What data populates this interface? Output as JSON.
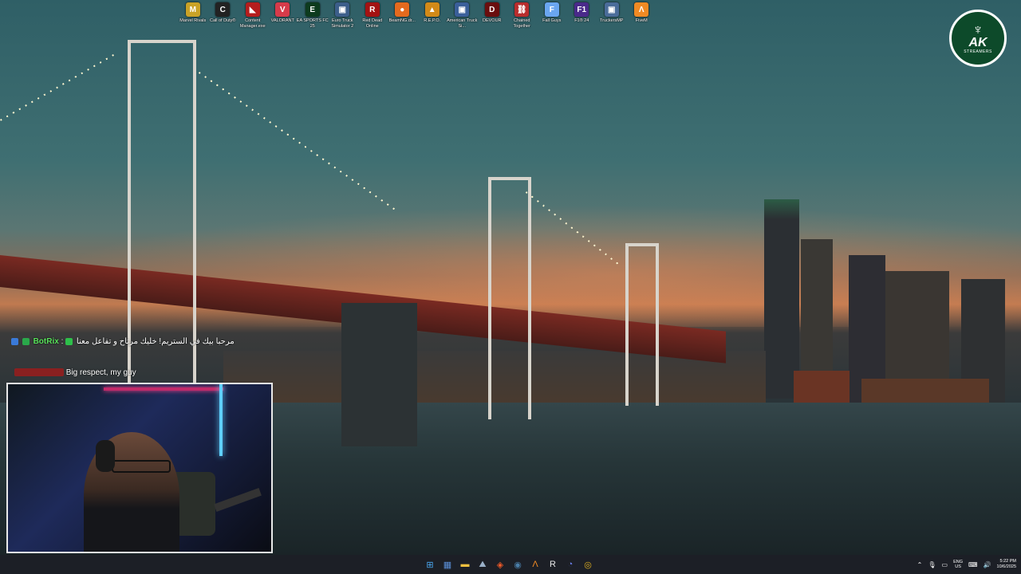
{
  "desktop": {
    "icons": [
      {
        "label": "Marvel Rivals",
        "icon": "marvel-rivals-icon",
        "color": "#c9a227",
        "glyph": "M"
      },
      {
        "label": "Call of Duty®",
        "icon": "call-of-duty-icon",
        "color": "#222222",
        "glyph": "C"
      },
      {
        "label": "Content Manager.exe",
        "icon": "content-manager-icon",
        "color": "#b51d1d",
        "glyph": "◣"
      },
      {
        "label": "VALORANT",
        "icon": "valorant-icon",
        "color": "#d63b4a",
        "glyph": "V"
      },
      {
        "label": "EA SPORTS FC 25",
        "icon": "ea-fc25-icon",
        "color": "#0d3b1e",
        "glyph": "E"
      },
      {
        "label": "Euro Truck Simulator 2",
        "icon": "euro-truck-icon",
        "color": "#3c5e8a",
        "glyph": "▣"
      },
      {
        "label": "Red Dead Online",
        "icon": "red-dead-icon",
        "color": "#a31212",
        "glyph": "R"
      },
      {
        "label": "BeamNG.dr...",
        "icon": "beamng-icon",
        "color": "#e46a1e",
        "glyph": "●"
      },
      {
        "label": "R.E.P.O.",
        "icon": "repo-icon",
        "color": "#d28a18",
        "glyph": "▲"
      },
      {
        "label": "American Truck Si...",
        "icon": "american-truck-icon",
        "color": "#3a5f9a",
        "glyph": "▣"
      },
      {
        "label": "DEVOUR",
        "icon": "devour-icon",
        "color": "#6a0e0e",
        "glyph": "D"
      },
      {
        "label": "Chained Together",
        "icon": "chained-together-icon",
        "color": "#b82d2d",
        "glyph": "⛓"
      },
      {
        "label": "Fall Guys",
        "icon": "fall-guys-icon",
        "color": "#6aa6f0",
        "glyph": "F"
      },
      {
        "label": "F1® 24",
        "icon": "f1-24-icon",
        "color": "#4a2a8a",
        "glyph": "F1"
      },
      {
        "label": "TruckersMP",
        "icon": "truckersmp-icon",
        "color": "#4a6c9a",
        "glyph": "▣"
      },
      {
        "label": "FiveM",
        "icon": "fivem-icon",
        "color": "#f08a24",
        "glyph": "Λ"
      }
    ]
  },
  "logo": {
    "title": "AK",
    "subtitle": "STREAMERS"
  },
  "chat": {
    "messages": [
      {
        "user": "BotRix",
        "separator": ":",
        "text": "مرحبا بيك في الستريم! خليك مرتاح و تفاعل معنا",
        "user_color": "#58e05a"
      },
      {
        "user": "",
        "separator": ":",
        "text": "Big respect, my guy",
        "user_color": "#e03c3c"
      }
    ]
  },
  "taskbar": {
    "apps": [
      {
        "icon": "windows-start-icon",
        "glyph": "⊞",
        "color": "#4aa8f0"
      },
      {
        "icon": "calendar-icon",
        "glyph": "▦",
        "color": "#5a8fd8"
      },
      {
        "icon": "file-explorer-icon",
        "glyph": "▬",
        "color": "#f0c040"
      },
      {
        "icon": "photos-icon",
        "glyph": "⛰",
        "color": "#9ab0c8"
      },
      {
        "icon": "brave-browser-icon",
        "glyph": "◈",
        "color": "#f05a28"
      },
      {
        "icon": "steam-icon",
        "glyph": "◉",
        "color": "#4a7ea8"
      },
      {
        "icon": "fivem-taskbar-icon",
        "glyph": "Λ",
        "color": "#f08a24"
      },
      {
        "icon": "rockstar-icon",
        "glyph": "R",
        "color": "#e8e8e8"
      },
      {
        "icon": "discord-icon",
        "glyph": "◔",
        "color": "#6a7ee8"
      },
      {
        "icon": "chrome-icon",
        "glyph": "◎",
        "color": "#e0b020"
      }
    ],
    "tray": {
      "lang_top": "ENG",
      "lang_bottom": "US",
      "time": "5:22 PM",
      "date": "10/6/2025"
    }
  }
}
